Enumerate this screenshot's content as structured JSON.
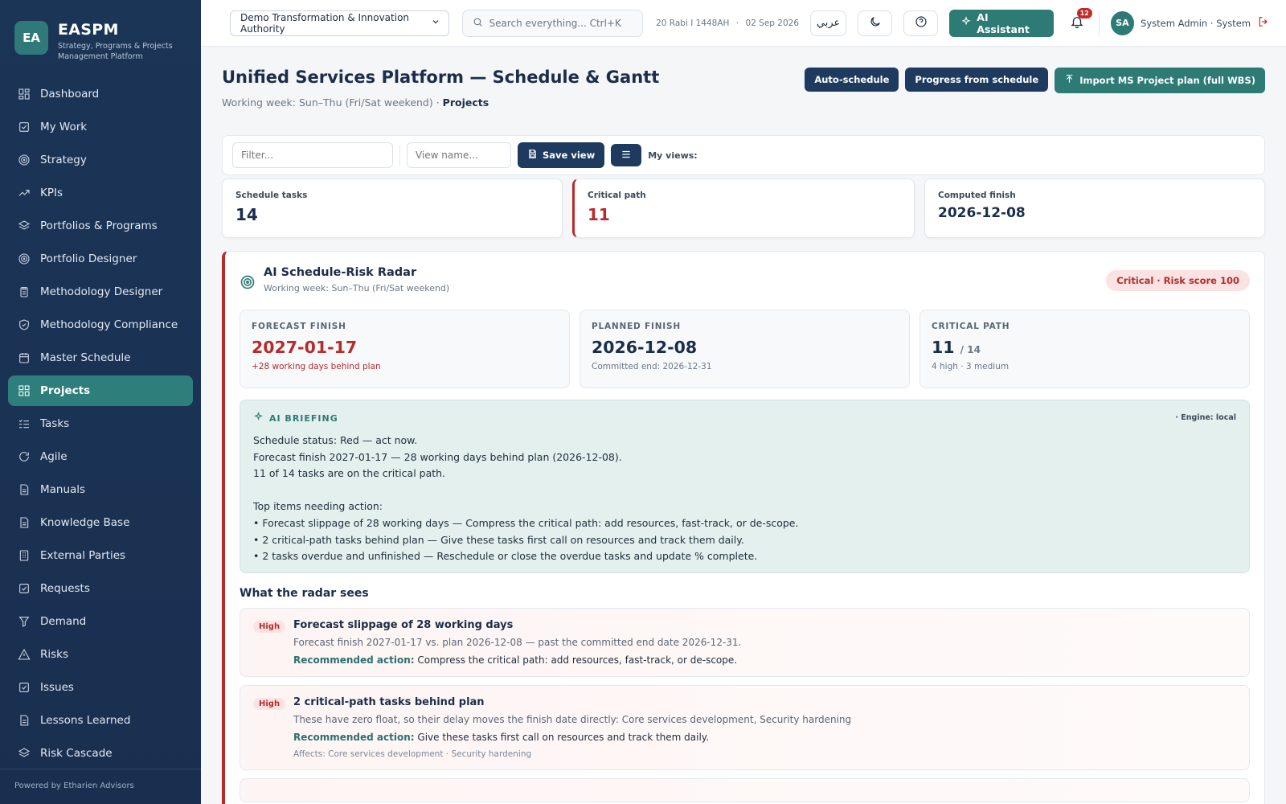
{
  "sidebar": {
    "logo": "EA",
    "app_name": "EASPM",
    "app_subtitle": "Strategy, Programs & Projects Management Platform",
    "items": [
      {
        "label": "Dashboard",
        "icon": "dashboard-icon"
      },
      {
        "label": "My Work",
        "icon": "check-square-icon"
      },
      {
        "label": "Strategy",
        "icon": "target-icon"
      },
      {
        "label": "KPIs",
        "icon": "trend-icon"
      },
      {
        "label": "Portfolios & Programs",
        "icon": "layers-icon"
      },
      {
        "label": "Portfolio Designer",
        "icon": "target-icon"
      },
      {
        "label": "Methodology Designer",
        "icon": "clipboard-icon"
      },
      {
        "label": "Methodology Compliance",
        "icon": "shield-icon"
      },
      {
        "label": "Master Schedule",
        "icon": "calendar-icon"
      },
      {
        "label": "Projects",
        "icon": "grid-icon"
      },
      {
        "label": "Tasks",
        "icon": "list-check-icon"
      },
      {
        "label": "Agile",
        "icon": "refresh-icon"
      },
      {
        "label": "Manuals",
        "icon": "file-icon"
      },
      {
        "label": "Knowledge Base",
        "icon": "file-icon"
      },
      {
        "label": "External Parties",
        "icon": "building-icon"
      },
      {
        "label": "Requests",
        "icon": "check-square-icon"
      },
      {
        "label": "Demand",
        "icon": "filter-icon"
      },
      {
        "label": "Risks",
        "icon": "warning-icon"
      },
      {
        "label": "Issues",
        "icon": "check-square-icon"
      },
      {
        "label": "Lessons Learned",
        "icon": "file-icon"
      },
      {
        "label": "Risk Cascade",
        "icon": "layers-icon"
      }
    ],
    "active_index": 9,
    "footer": "Powered by Etharien Advisors"
  },
  "topbar": {
    "org": "Demo Transformation & Innovation Authority",
    "search_placeholder": "Search everything...  Ctrl+K",
    "hijri_date": "20 Rabi I 1448AH",
    "date_sep": "·",
    "gregorian_date": "02 Sep 2026",
    "lang_toggle": "عربي",
    "ai_label": "AI Assistant",
    "notifications": "12",
    "avatar": "SA",
    "user": "System Admin · System Administrator"
  },
  "header": {
    "title": "Unified Services Platform — Schedule & Gantt",
    "subtitle": "Working week: Sun–Thu (Fri/Sat weekend) · ",
    "breadcrumb": "Projects",
    "actions": {
      "auto_schedule": "Auto-schedule",
      "progress": "Progress from schedule",
      "import": "Import MS Project plan (full WBS)"
    }
  },
  "filterbar": {
    "filter_placeholder": "Filter...",
    "view_placeholder": "View name...",
    "save": "Save view",
    "my_views": "My views:"
  },
  "stats": [
    {
      "label": "Schedule tasks",
      "value": "14"
    },
    {
      "label": "Critical path",
      "value": "11"
    },
    {
      "label": "Computed finish",
      "value": "2026-12-08"
    }
  ],
  "radar": {
    "title": "AI Schedule-Risk Radar",
    "subtitle": "Working week: Sun–Thu (Fri/Sat weekend)",
    "badge": "Critical · Risk score 100",
    "metrics": [
      {
        "label": "FORECAST FINISH",
        "value": "2027-01-17",
        "sub": "+28 working days behind plan"
      },
      {
        "label": "PLANNED FINISH",
        "value": "2026-12-08",
        "sub": "Committed end: 2026-12-31"
      },
      {
        "label": "CRITICAL PATH",
        "value": "11",
        "value_suffix": "/ 14",
        "sub": "4 high · 3 medium"
      }
    ],
    "briefing": {
      "title": "AI BRIEFING",
      "engine": "· Engine: local",
      "lines": [
        "Schedule status: Red — act now.",
        "Forecast finish 2027-01-17 — 28 working days behind plan (2026-12-08).",
        "11 of 14 tasks are on the critical path."
      ],
      "action_title": "Top items needing action:",
      "actions": [
        "• Forecast slippage of 28 working days — Compress the critical path: add resources, fast-track, or de-scope.",
        "• 2 critical-path tasks behind plan — Give these tasks first call on resources and track them daily.",
        "• 2 tasks overdue and unfinished — Reschedule or close the overdue tasks and update % complete."
      ]
    },
    "section_title": "What the radar sees",
    "findings": [
      {
        "severity": "High",
        "title": "Forecast slippage of 28 working days",
        "desc": "Forecast finish 2027-01-17 vs. plan 2026-12-08 — past the committed end date 2026-12-31.",
        "action_label": "Recommended action:",
        "action": " Compress the critical path: add resources, fast-track, or de-scope.",
        "affects": ""
      },
      {
        "severity": "High",
        "title": "2 critical-path tasks behind plan",
        "desc": "These have zero float, so their delay moves the finish date directly: Core services development, Security hardening",
        "action_label": "Recommended action:",
        "action": " Give these tasks first call on resources and track them daily.",
        "affects": "Affects: Core services development · Security hardening"
      }
    ]
  },
  "colors": {
    "sidebar": "#1b3557",
    "accent_teal": "#2e7a75",
    "navy": "#1e3a5f",
    "critical_red": "#b72b2b"
  }
}
